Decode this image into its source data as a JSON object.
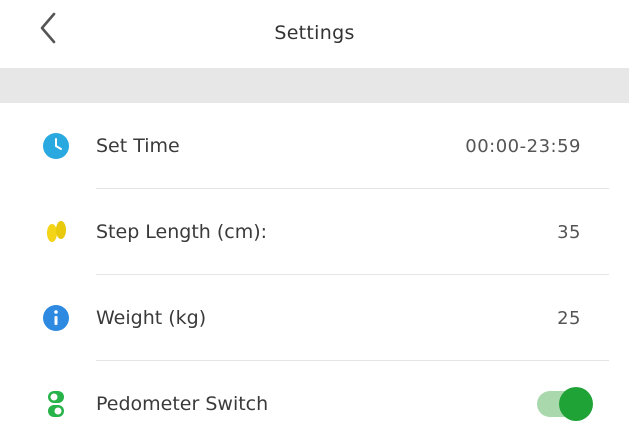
{
  "header": {
    "title": "Settings",
    "back_icon": "chevron-left-icon"
  },
  "settings": {
    "items": [
      {
        "label": "Set Time",
        "value": "00:00-23:59",
        "icon": "clock-icon",
        "icon_color": "#29a9e0"
      },
      {
        "label": "Step Length (cm):",
        "value": "35",
        "icon": "footprints-icon",
        "icon_color": "#f3d416"
      },
      {
        "label": "Weight (kg)",
        "value": "25",
        "icon": "info-icon",
        "icon_color": "#2d8ae0"
      },
      {
        "label": "Pedometer Switch",
        "icon": "switch-icon",
        "icon_color": "#27b24a",
        "toggle_on": true
      }
    ]
  },
  "colors": {
    "toggle_track": "#a9d8ad",
    "toggle_knob": "#1fa336",
    "section_band": "#e7e7e7"
  }
}
